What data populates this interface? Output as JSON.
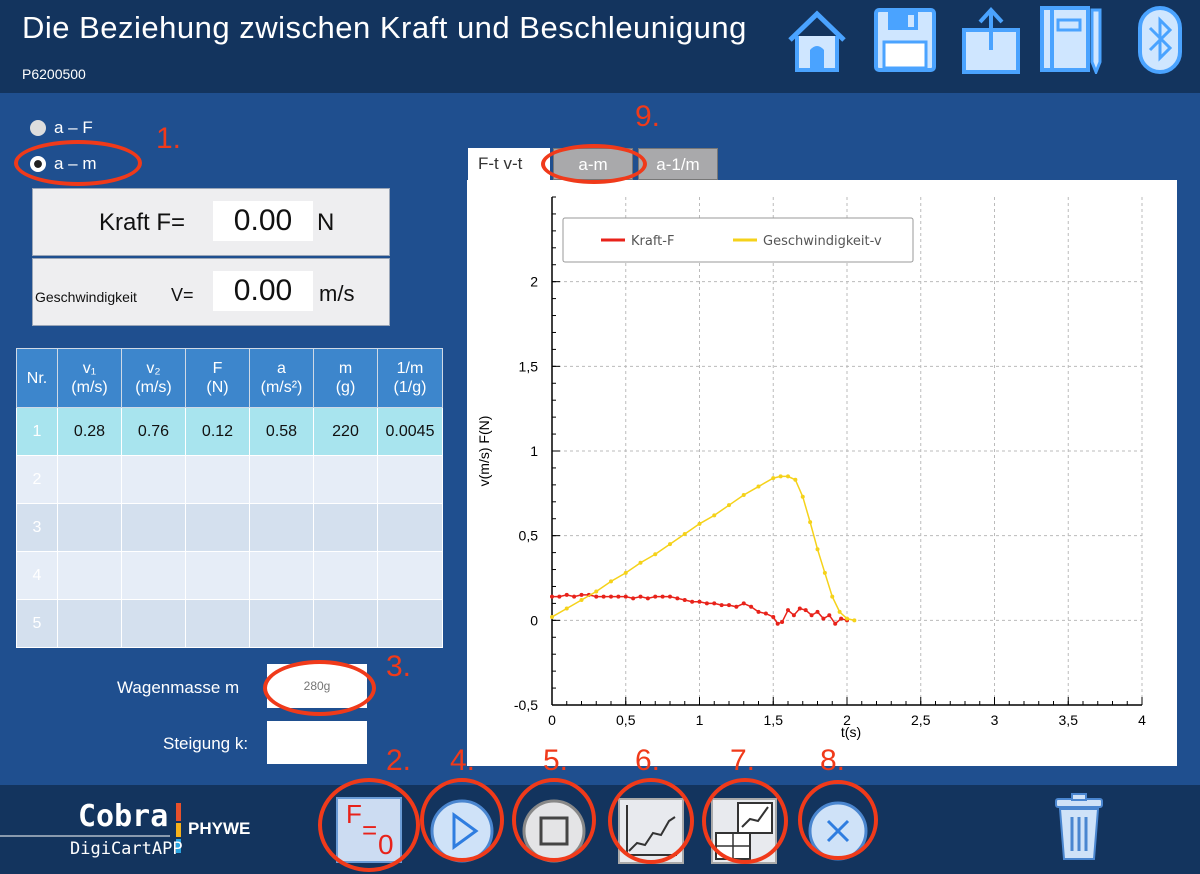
{
  "header": {
    "title": "Die Beziehung zwischen Kraft und Beschleunigung",
    "subtitle": "P6200500",
    "icons": [
      "home-icon",
      "save-icon",
      "export-icon",
      "notebook-icon",
      "bluetooth-icon"
    ]
  },
  "modes": {
    "a_f": "a – F",
    "a_m": "a – m",
    "selected": "a – m"
  },
  "readouts": {
    "force_label": "Kraft F=",
    "force_value": "0.00",
    "force_unit": "N",
    "speed_label": "Geschwindigkeit",
    "speed_var": "V=",
    "speed_value": "0.00",
    "speed_unit": "m/s"
  },
  "table": {
    "headers": [
      {
        "top": "Nr.",
        "bottom": ""
      },
      {
        "top": "v₁",
        "bottom": "(m/s)"
      },
      {
        "top": "v₂",
        "bottom": "(m/s)"
      },
      {
        "top": "F",
        "bottom": "(N)"
      },
      {
        "top": "a",
        "bottom": "(m/s²)"
      },
      {
        "top": "m",
        "bottom": "(g)"
      },
      {
        "top": "1/m",
        "bottom": "(1/g)"
      }
    ],
    "rows": [
      [
        "1",
        "0.28",
        "0.76",
        "0.12",
        "0.58",
        "220",
        "0.0045"
      ],
      [
        "2",
        "",
        "",
        "",
        "",
        "",
        ""
      ],
      [
        "3",
        "",
        "",
        "",
        "",
        "",
        ""
      ],
      [
        "4",
        "",
        "",
        "",
        "",
        "",
        ""
      ],
      [
        "5",
        "",
        "",
        "",
        "",
        "",
        ""
      ]
    ]
  },
  "fields": {
    "mass_label": "Wagenmasse m",
    "mass_placeholder": "280g",
    "slope_label": "Steigung k:",
    "slope_value": ""
  },
  "tabs": {
    "ft_vt": "F-t v-t",
    "am": "a-m",
    "a1m": "a-1/m"
  },
  "annotations": [
    "1.",
    "2.",
    "3.",
    "4.",
    "5.",
    "6.",
    "7.",
    "8.",
    "9."
  ],
  "brand": {
    "name": "Cobra",
    "sub": "DigiCartAPP",
    "company": "PHYWE"
  },
  "buttons": {
    "zero_label": "F",
    "zero_eq": "=",
    "zero_val": "0"
  },
  "colors": {
    "force_series": "#e8221a",
    "speed_series": "#f5d21a",
    "annotation": "#f03a1a",
    "header_bg": "#13345e",
    "panel_bg": "#1f4f8f"
  },
  "chart_data": {
    "type": "line",
    "xlabel": "t(s)",
    "ylabel": "v(m/s) F(N)",
    "xlim": [
      0,
      4
    ],
    "ylim": [
      -0.5,
      2.5
    ],
    "x_ticks": [
      "0",
      "0,5",
      "1",
      "1,5",
      "2",
      "2,5",
      "3",
      "3,5",
      "4"
    ],
    "y_ticks": [
      "-0,5",
      "0",
      "0,5",
      "1",
      "1,5",
      "2"
    ],
    "legend_position": "top-left",
    "grid": true,
    "series": [
      {
        "name": "Kraft-F",
        "color": "#e8221a",
        "x": [
          0,
          0.05,
          0.1,
          0.15,
          0.2,
          0.25,
          0.3,
          0.35,
          0.4,
          0.45,
          0.5,
          0.55,
          0.6,
          0.65,
          0.7,
          0.75,
          0.8,
          0.85,
          0.9,
          0.95,
          1.0,
          1.05,
          1.1,
          1.15,
          1.2,
          1.25,
          1.3,
          1.35,
          1.4,
          1.45,
          1.5,
          1.53,
          1.56,
          1.6,
          1.64,
          1.68,
          1.72,
          1.76,
          1.8,
          1.84,
          1.88,
          1.92,
          1.96,
          2.0
        ],
        "y": [
          0.14,
          0.14,
          0.15,
          0.14,
          0.15,
          0.15,
          0.14,
          0.14,
          0.14,
          0.14,
          0.14,
          0.13,
          0.14,
          0.13,
          0.14,
          0.14,
          0.14,
          0.13,
          0.12,
          0.11,
          0.11,
          0.1,
          0.1,
          0.09,
          0.09,
          0.08,
          0.1,
          0.08,
          0.05,
          0.04,
          0.02,
          -0.02,
          -0.01,
          0.06,
          0.03,
          0.07,
          0.06,
          0.03,
          0.05,
          0.01,
          0.03,
          -0.02,
          0.01,
          0.0
        ]
      },
      {
        "name": "Geschwindigkeit-v",
        "color": "#f5d21a",
        "x": [
          0,
          0.1,
          0.2,
          0.3,
          0.4,
          0.5,
          0.6,
          0.7,
          0.8,
          0.9,
          1.0,
          1.1,
          1.2,
          1.3,
          1.4,
          1.5,
          1.55,
          1.6,
          1.65,
          1.7,
          1.75,
          1.8,
          1.85,
          1.9,
          1.95,
          2.0,
          2.05
        ],
        "y": [
          0.02,
          0.07,
          0.12,
          0.17,
          0.23,
          0.28,
          0.34,
          0.39,
          0.45,
          0.51,
          0.57,
          0.62,
          0.68,
          0.74,
          0.79,
          0.84,
          0.85,
          0.85,
          0.83,
          0.73,
          0.58,
          0.42,
          0.28,
          0.14,
          0.05,
          0.01,
          0.0
        ]
      }
    ]
  }
}
